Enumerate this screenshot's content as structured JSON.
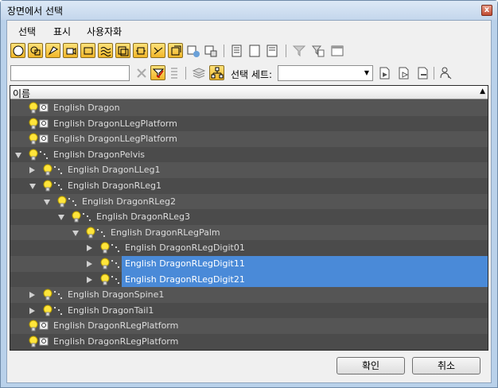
{
  "window": {
    "title": "장면에서 선택",
    "close_glyph": "x"
  },
  "menu": [
    "선택",
    "표시",
    "사용자화"
  ],
  "toolbar2": {
    "search_value": "",
    "selection_set_label": "선택 세트:",
    "selection_set_value": ""
  },
  "tree": {
    "column_header": "이름",
    "rows": [
      {
        "label": "English Dragon",
        "icon": "object-icon",
        "expander": "none",
        "selected": false
      },
      {
        "label": "English DragonLLegPlatform",
        "icon": "object-icon",
        "expander": "none",
        "selected": false
      },
      {
        "label": "English DragonLLegPlatform",
        "icon": "object-icon",
        "expander": "none",
        "selected": false
      },
      {
        "label": "English DragonPelvis",
        "icon": "bone-icon",
        "expander": "expanded",
        "selected": false
      },
      {
        "label": "English DragonLLeg1",
        "icon": "bone-icon",
        "expander": "collapsed",
        "selected": false
      },
      {
        "label": "English DragonRLeg1",
        "icon": "bone-icon",
        "expander": "expanded",
        "selected": false
      },
      {
        "label": "English DragonRLeg2",
        "icon": "bone-icon",
        "expander": "expanded",
        "selected": false
      },
      {
        "label": "English DragonRLeg3",
        "icon": "bone-icon",
        "expander": "expanded",
        "selected": false
      },
      {
        "label": "English DragonRLegPalm",
        "icon": "bone-icon",
        "expander": "expanded",
        "selected": false
      },
      {
        "label": "English DragonRLegDigit01",
        "icon": "bone-icon",
        "expander": "collapsed",
        "selected": false
      },
      {
        "label": "English DragonRLegDigit11",
        "icon": "bone-icon",
        "expander": "collapsed",
        "selected": true
      },
      {
        "label": "English DragonRLegDigit21",
        "icon": "bone-icon",
        "expander": "collapsed",
        "selected": true
      },
      {
        "label": "English DragonSpine1",
        "icon": "bone-icon",
        "expander": "collapsed",
        "selected": false
      },
      {
        "label": "English DragonTail1",
        "icon": "bone-icon",
        "expander": "collapsed",
        "selected": false
      },
      {
        "label": "English DragonRLegPlatform",
        "icon": "object-icon",
        "expander": "none",
        "selected": false
      },
      {
        "label": "English DragonRLegPlatform",
        "icon": "object-icon",
        "expander": "none",
        "selected": false
      }
    ]
  },
  "buttons": {
    "ok": "확인",
    "cancel": "취소"
  },
  "colors": {
    "tree_bg": "#4e4e4e",
    "selection": "#4a8ad8",
    "toolbar_active": "#f1b629"
  }
}
